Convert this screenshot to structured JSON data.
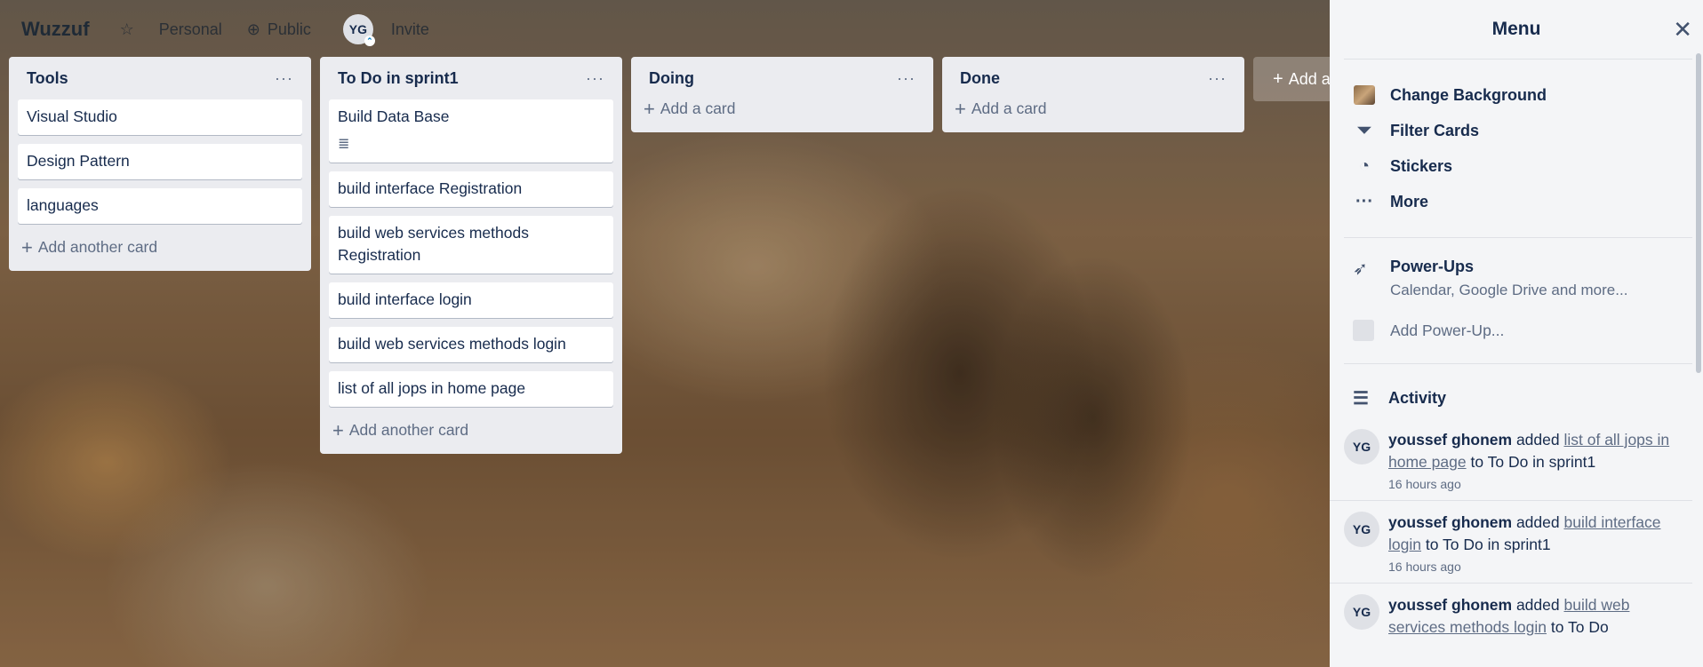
{
  "board": {
    "title": "Wuzzuf",
    "star_icon": "star-icon",
    "visibility_workspace": "Personal",
    "visibility_public": "Public",
    "member_initials": "YG",
    "invite_label": "Invite"
  },
  "lists": [
    {
      "title": "Tools",
      "cards": [
        "Visual Studio",
        "Design Pattern",
        "languages"
      ],
      "add_label": "Add another card"
    },
    {
      "title": "To Do in sprint1",
      "cards": [
        "Build Data Base",
        "build interface Registration",
        "build web services methods Registration",
        "build interface login",
        "build web services methods login",
        "list of all jops in home page"
      ],
      "add_label": "Add another card"
    },
    {
      "title": "Doing",
      "cards": [],
      "add_label": "Add a card"
    },
    {
      "title": "Done",
      "cards": [],
      "add_label": "Add a card"
    }
  ],
  "add_list_label": "Add a",
  "menu": {
    "title": "Menu",
    "items": [
      "Change Background",
      "Filter Cards",
      "Stickers",
      "More"
    ],
    "powerups_title": "Power-Ups",
    "powerups_sub": "Calendar, Google Drive and more...",
    "add_powerup": "Add Power-Up...",
    "activity_title": "Activity",
    "activities": [
      {
        "initials": "YG",
        "user": "youssef ghonem",
        "verb": "added",
        "link": "list of all jops in home page",
        "target": "to To Do in sprint1",
        "time": "16 hours ago"
      },
      {
        "initials": "YG",
        "user": "youssef ghonem",
        "verb": "added",
        "link": "build interface login",
        "target": "to To Do in sprint1",
        "time": "16 hours ago"
      },
      {
        "initials": "YG",
        "user": "youssef ghonem",
        "verb": "added",
        "link": "build web services methods login",
        "target": "to To Do",
        "time": ""
      }
    ]
  }
}
